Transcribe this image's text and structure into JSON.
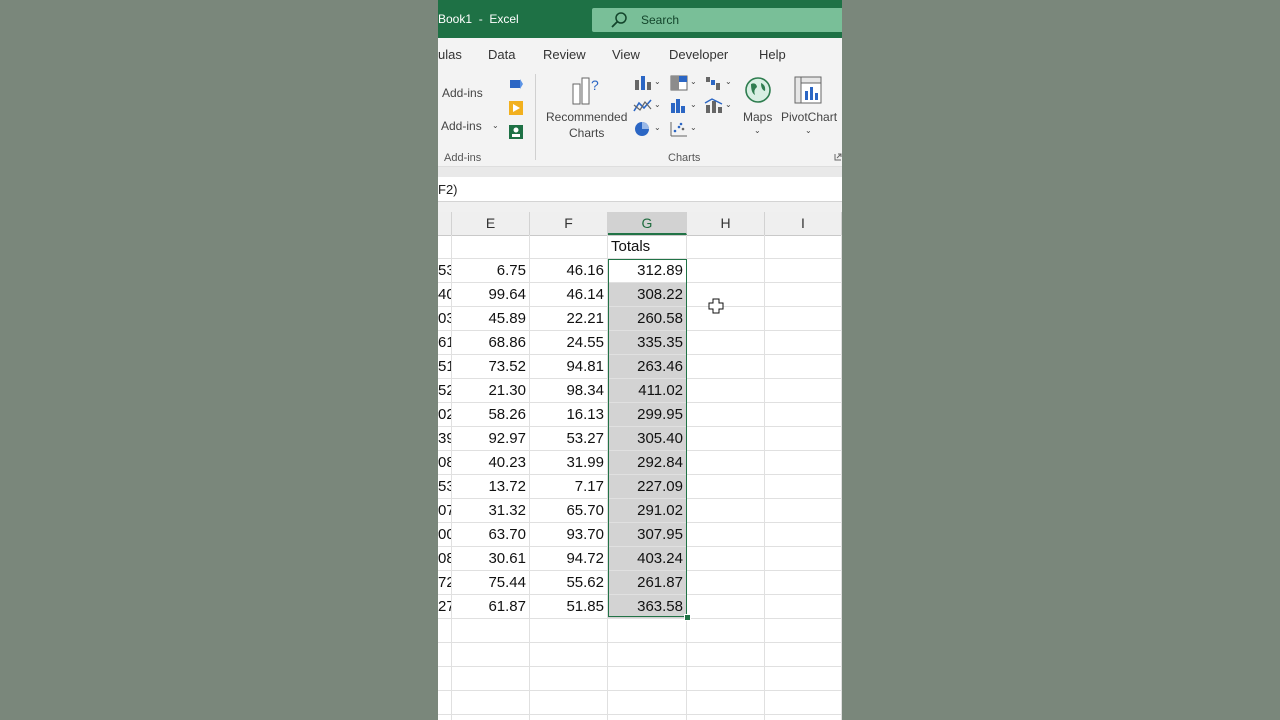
{
  "titlebar": {
    "title": "Book1  -  Excel",
    "search_placeholder": "Search"
  },
  "tabs": [
    "ulas",
    "Data",
    "Review",
    "View",
    "Developer",
    "Help"
  ],
  "ribbon": {
    "addins_buttons": [
      "Add-ins",
      "Add-ins"
    ],
    "addins_group_label": "Add-ins",
    "recommended_charts_label": [
      "Recommended",
      "Charts"
    ],
    "maps_label": "Maps",
    "pivotchart_label": "PivotChart",
    "charts_group_label": "Charts"
  },
  "formula_bar": {
    "text": "F2)"
  },
  "grid": {
    "columns": [
      {
        "label": "",
        "selected": false
      },
      {
        "label": "E",
        "selected": false
      },
      {
        "label": "F",
        "selected": false
      },
      {
        "label": "G",
        "selected": true
      },
      {
        "label": "H",
        "selected": false
      },
      {
        "label": "I",
        "selected": false
      }
    ],
    "header_row": {
      "G": "Totals"
    },
    "rows": [
      {
        "D": "53",
        "E": "6.75",
        "F": "46.16",
        "G": "312.89"
      },
      {
        "D": "40",
        "E": "99.64",
        "F": "46.14",
        "G": "308.22"
      },
      {
        "D": "03",
        "E": "45.89",
        "F": "22.21",
        "G": "260.58"
      },
      {
        "D": "61",
        "E": "68.86",
        "F": "24.55",
        "G": "335.35"
      },
      {
        "D": "51",
        "E": "73.52",
        "F": "94.81",
        "G": "263.46"
      },
      {
        "D": "52",
        "E": "21.30",
        "F": "98.34",
        "G": "411.02"
      },
      {
        "D": "02",
        "E": "58.26",
        "F": "16.13",
        "G": "299.95"
      },
      {
        "D": "39",
        "E": "92.97",
        "F": "53.27",
        "G": "305.40"
      },
      {
        "D": "08",
        "E": "40.23",
        "F": "31.99",
        "G": "292.84"
      },
      {
        "D": "53",
        "E": "13.72",
        "F": "7.17",
        "G": "227.09"
      },
      {
        "D": "07",
        "E": "31.32",
        "F": "65.70",
        "G": "291.02"
      },
      {
        "D": "00",
        "E": "63.70",
        "F": "93.70",
        "G": "307.95"
      },
      {
        "D": "08",
        "E": "30.61",
        "F": "94.72",
        "G": "403.24"
      },
      {
        "D": "72",
        "E": "75.44",
        "F": "55.62",
        "G": "261.87"
      },
      {
        "D": "27",
        "E": "61.87",
        "F": "51.85",
        "G": "363.58"
      }
    ]
  }
}
